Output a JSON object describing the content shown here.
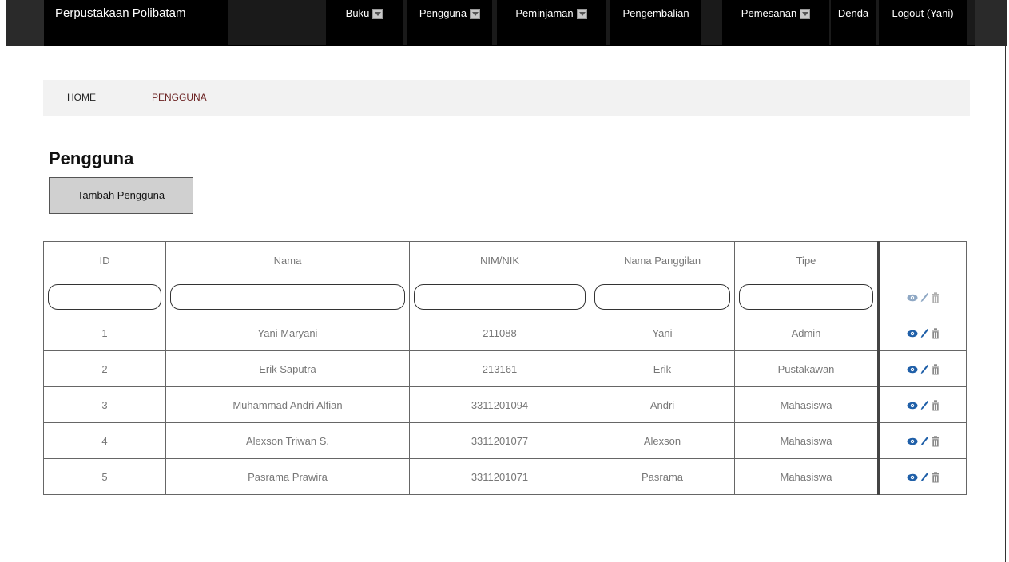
{
  "nav": {
    "brand": "Perpustakaan Polibatam",
    "items": [
      {
        "label": "Buku",
        "dropdown": true
      },
      {
        "label": "Pengguna",
        "dropdown": true
      },
      {
        "label": "Peminjaman",
        "dropdown": true
      },
      {
        "label": "Pengembalian",
        "dropdown": false
      },
      {
        "label": "Pemesanan",
        "dropdown": true
      },
      {
        "label": "Denda",
        "dropdown": false
      },
      {
        "label": "Logout (Yani)",
        "dropdown": false
      }
    ]
  },
  "breadcrumb": {
    "home": "HOME",
    "current": "PENGGUNA"
  },
  "page": {
    "title": "Pengguna",
    "add_button": "Tambah Pengguna"
  },
  "table": {
    "headers": [
      "ID",
      "Nama",
      "NIM/NIK",
      "Nama Panggilan",
      "Tipe"
    ],
    "rows": [
      {
        "id": "1",
        "nama": "Yani Maryani",
        "nim": "211088",
        "panggilan": "Yani",
        "tipe": "Admin"
      },
      {
        "id": "2",
        "nama": "Erik Saputra",
        "nim": "213161",
        "panggilan": "Erik",
        "tipe": "Pustakawan"
      },
      {
        "id": "3",
        "nama": "Muhammad Andri Alfian",
        "nim": "3311201094",
        "panggilan": "Andri",
        "tipe": "Mahasiswa"
      },
      {
        "id": "4",
        "nama": "Alexson Triwan S.",
        "nim": "3311201077",
        "panggilan": "Alexson",
        "tipe": "Mahasiswa"
      },
      {
        "id": "5",
        "nama": "Pasrama Prawira",
        "nim": "3311201071",
        "panggilan": "Pasrama",
        "tipe": "Mahasiswa"
      }
    ]
  },
  "colors": {
    "nav_bg": "#000000",
    "icon_blue": "#1f5fa8",
    "icon_gray": "#8a8a8a",
    "crumb_active": "#6b2222"
  },
  "icons": [
    "eye-icon",
    "pencil-icon",
    "trash-icon"
  ]
}
